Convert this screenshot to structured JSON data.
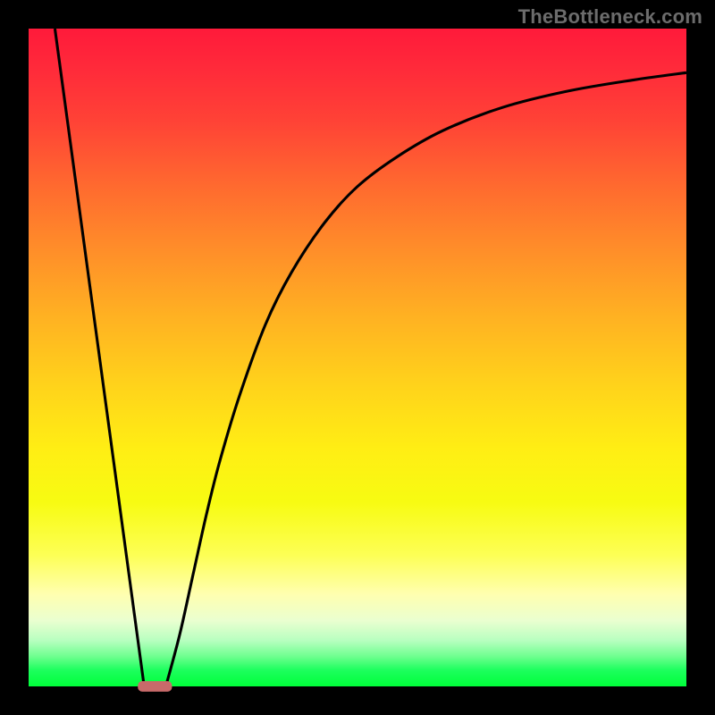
{
  "watermark": "TheBottleneck.com",
  "colors": {
    "page_bg": "#000000",
    "curve": "#000000",
    "marker": "#c86a6a",
    "gradient_top": "#ff1a3a",
    "gradient_bottom": "#00ff3a"
  },
  "chart_data": {
    "type": "line",
    "title": "",
    "xlabel": "",
    "ylabel": "",
    "xlim": [
      0,
      100
    ],
    "ylim": [
      0,
      100
    ],
    "axes_visible": false,
    "grid": false,
    "legend": false,
    "background": "vertical-gradient red→orange→yellow→green",
    "series": [
      {
        "name": "left-descent",
        "segment": "line",
        "x": [
          4.0,
          17.5
        ],
        "y": [
          100.0,
          0.5
        ]
      },
      {
        "name": "right-ascent",
        "segment": "curve",
        "x": [
          21.0,
          23.0,
          25.0,
          27.0,
          29.0,
          32.0,
          36.0,
          40.0,
          45.0,
          50.0,
          56.0,
          63.0,
          72.0,
          82.0,
          92.0,
          100.0
        ],
        "y": [
          0.5,
          8.0,
          17.0,
          26.0,
          34.0,
          44.0,
          55.0,
          63.0,
          70.5,
          76.0,
          80.5,
          84.5,
          88.0,
          90.5,
          92.2,
          93.3
        ]
      }
    ],
    "marker": {
      "shape": "rounded-rect",
      "x_center": 19.2,
      "y_center": 0.0,
      "width": 5.2,
      "height": 1.6,
      "color": "#c86a6a"
    }
  }
}
